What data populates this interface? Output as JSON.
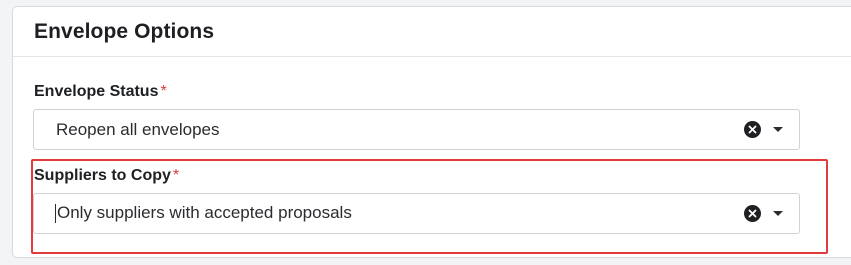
{
  "panel": {
    "title": "Envelope Options"
  },
  "fields": [
    {
      "label": "Envelope Status",
      "required_marker": "*",
      "value": "Reopen all envelopes"
    },
    {
      "label": "Suppliers to Copy",
      "required_marker": "*",
      "value": "Only suppliers with accepted proposals"
    }
  ],
  "highlight": {
    "color": "#e23b3b"
  },
  "icons": {
    "clear": "clear-icon",
    "dropdown": "chevron-down-icon"
  }
}
